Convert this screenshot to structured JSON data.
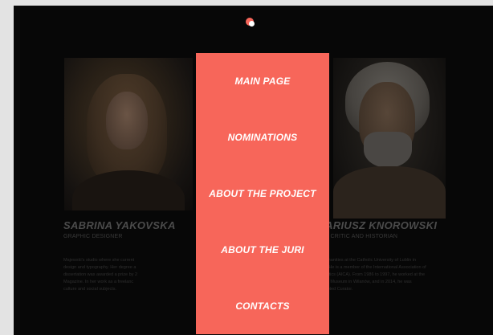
{
  "colors": {
    "menu_background": "#f7665a",
    "page_background": "#070707",
    "menu_text": "#ffffff"
  },
  "menu": {
    "items": [
      {
        "label": "MAIN PAGE"
      },
      {
        "label": "NOMINATIONS"
      },
      {
        "label": "ABOUT THE PROJECT"
      },
      {
        "label": "ABOUT THE JURI"
      },
      {
        "label": "CONTACTS"
      }
    ]
  },
  "jury": [
    {
      "name": "SABRINA YAKOVSKA",
      "role": "GRAPHIC DESIGNER",
      "bio": [
        "Majewski's studio where she current",
        "design and typography. Her degree a",
        "dissertation was awarded a prize by 2",
        "Magazine. In her work as a freelanc",
        "culture and social subjects."
      ]
    },
    {
      "name": "MARIUSZ KNOROWSKI",
      "role": "ART CRITIC AND HISTORIAN",
      "bio": [
        "of Humanities at the Catholic University of Lublin in",
        "1986. He is a member of the International Association of",
        "Art Critics (AICA). From 1986 to 1997, he worked at the",
        "Poster Museum in Wilanów, and in 2014, he was",
        "appointed Curator."
      ]
    }
  ],
  "icons": {
    "menu_indicator": "toggle-dot-icon"
  }
}
